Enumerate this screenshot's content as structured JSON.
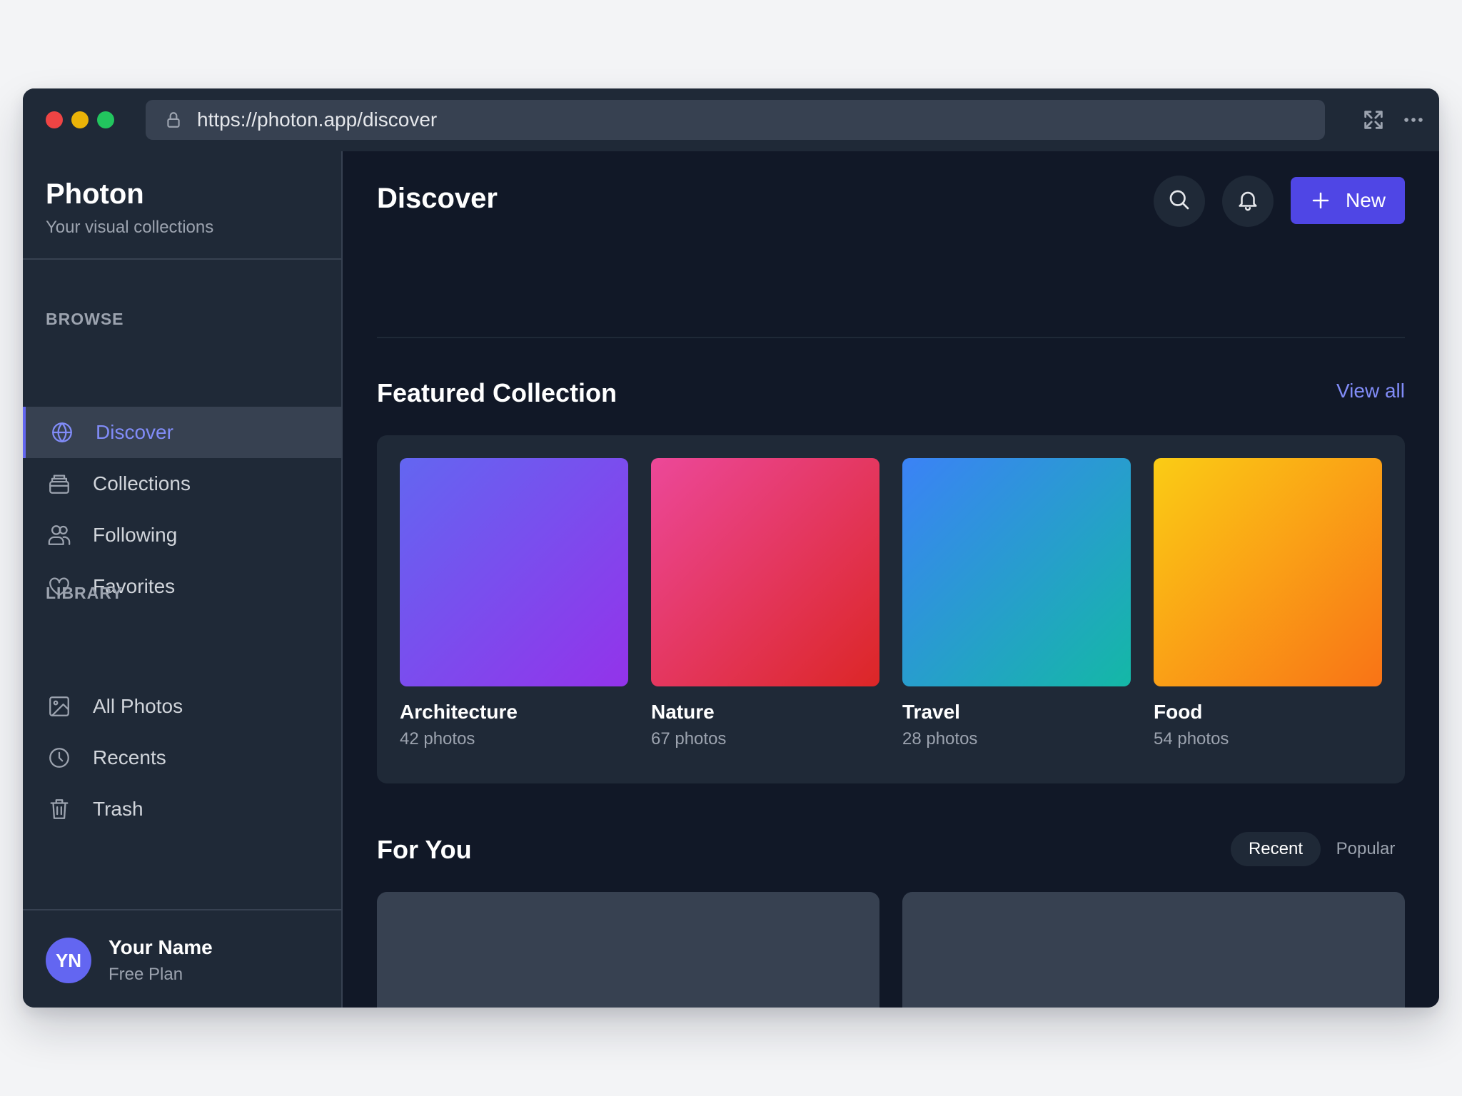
{
  "browser": {
    "url": "https://photon.app/discover"
  },
  "sidebar": {
    "app_name": "Photon",
    "app_tagline": "Your visual collections",
    "browse_label": "BROWSE",
    "browse_items": [
      {
        "label": "Discover",
        "icon": "globe-icon",
        "active": true
      },
      {
        "label": "Collections",
        "icon": "collections-icon",
        "active": false
      },
      {
        "label": "Following",
        "icon": "users-icon",
        "active": false
      },
      {
        "label": "Favorites",
        "icon": "heart-icon",
        "active": false
      }
    ],
    "library_label": "LIBRARY",
    "library_items": [
      {
        "label": "All Photos",
        "icon": "image-icon"
      },
      {
        "label": "Recents",
        "icon": "clock-icon"
      },
      {
        "label": "Trash",
        "icon": "trash-icon"
      }
    ],
    "user": {
      "initials": "YN",
      "name": "Your Name",
      "plan": "Free Plan"
    }
  },
  "main": {
    "title": "Discover",
    "new_button_label": "New",
    "featured": {
      "title": "Featured Collection",
      "view_all_label": "View all",
      "collections": [
        {
          "name": "Architecture",
          "count": "42 photos"
        },
        {
          "name": "Nature",
          "count": "67 photos"
        },
        {
          "name": "Travel",
          "count": "28 photos"
        },
        {
          "name": "Food",
          "count": "54 photos"
        }
      ]
    },
    "for_you": {
      "title": "For You",
      "tabs": [
        {
          "label": "Recent",
          "selected": true
        },
        {
          "label": "Popular",
          "selected": false
        }
      ]
    }
  },
  "colors": {
    "accent": "#4f46e5",
    "accent_text": "#818cf8",
    "window_bg": "#111827",
    "sidebar_bg": "#1f2937"
  }
}
